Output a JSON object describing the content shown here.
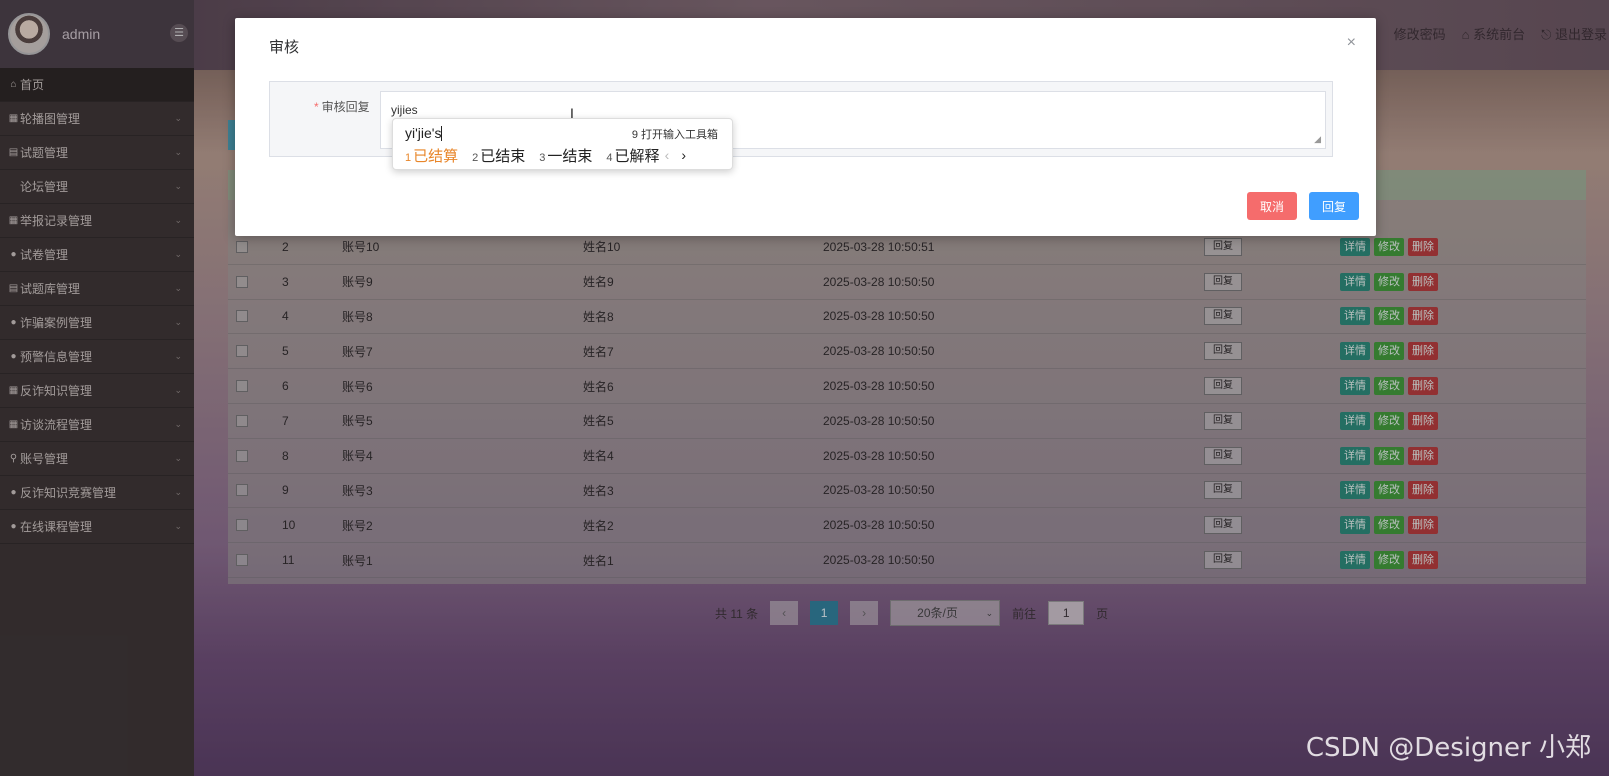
{
  "sidebar": {
    "user": "admin",
    "items": [
      {
        "icon": "⌂",
        "label": "首页"
      },
      {
        "icon": "▦",
        "label": "轮播图管理"
      },
      {
        "icon": "▤",
        "label": "试题管理"
      },
      {
        "icon": "",
        "label": "论坛管理"
      },
      {
        "icon": "▦",
        "label": "举报记录管理"
      },
      {
        "icon": "●",
        "label": "试卷管理"
      },
      {
        "icon": "▤",
        "label": "试题库管理"
      },
      {
        "icon": "●",
        "label": "诈骗案例管理"
      },
      {
        "icon": "●",
        "label": "预警信息管理"
      },
      {
        "icon": "▦",
        "label": "反诈知识管理"
      },
      {
        "icon": "▦",
        "label": "访谈流程管理"
      },
      {
        "icon": "⚲",
        "label": "账号管理"
      },
      {
        "icon": "●",
        "label": "反诈知识竞赛管理"
      },
      {
        "icon": "●",
        "label": "在线课程管理"
      }
    ]
  },
  "topbar": {
    "change_password": "修改密码",
    "front": "⌂ 系统前台",
    "logout": "⎋ 退出登录"
  },
  "table": {
    "reply_label": "回复",
    "detail_label": "详情",
    "edit_label": "修改",
    "delete_label": "删除",
    "rows": [
      {
        "idx": "2",
        "account": "账号10",
        "name": "姓名10",
        "time": "2025-03-28 10:50:51"
      },
      {
        "idx": "3",
        "account": "账号9",
        "name": "姓名9",
        "time": "2025-03-28 10:50:50"
      },
      {
        "idx": "4",
        "account": "账号8",
        "name": "姓名8",
        "time": "2025-03-28 10:50:50"
      },
      {
        "idx": "5",
        "account": "账号7",
        "name": "姓名7",
        "time": "2025-03-28 10:50:50"
      },
      {
        "idx": "6",
        "account": "账号6",
        "name": "姓名6",
        "time": "2025-03-28 10:50:50"
      },
      {
        "idx": "7",
        "account": "账号5",
        "name": "姓名5",
        "time": "2025-03-28 10:50:50"
      },
      {
        "idx": "8",
        "account": "账号4",
        "name": "姓名4",
        "time": "2025-03-28 10:50:50"
      },
      {
        "idx": "9",
        "account": "账号3",
        "name": "姓名3",
        "time": "2025-03-28 10:50:50"
      },
      {
        "idx": "10",
        "account": "账号2",
        "name": "姓名2",
        "time": "2025-03-28 10:50:50"
      },
      {
        "idx": "11",
        "account": "账号1",
        "name": "姓名1",
        "time": "2025-03-28 10:50:50"
      }
    ]
  },
  "pager": {
    "total": "共 11 条",
    "prev": "‹",
    "current": "1",
    "next": "›",
    "page_size": "20条/页",
    "goto_prefix": "前往",
    "goto_value": "1",
    "goto_suffix": "页"
  },
  "dialog": {
    "title": "审核",
    "close": "×",
    "field_label": "审核回复",
    "required_mark": "*",
    "reply_value": "yijies",
    "cancel": "取消",
    "submit": "回复"
  },
  "ime": {
    "composition": "yi'jie's",
    "toolbox": "9 打开输入工具箱",
    "candidates": [
      {
        "n": "1",
        "text": "已结算"
      },
      {
        "n": "2",
        "text": "已结束"
      },
      {
        "n": "3",
        "text": "一结束"
      },
      {
        "n": "4",
        "text": "已解释"
      }
    ],
    "prev": "‹",
    "next": "›"
  },
  "watermark": "CSDN @Designer 小郑"
}
